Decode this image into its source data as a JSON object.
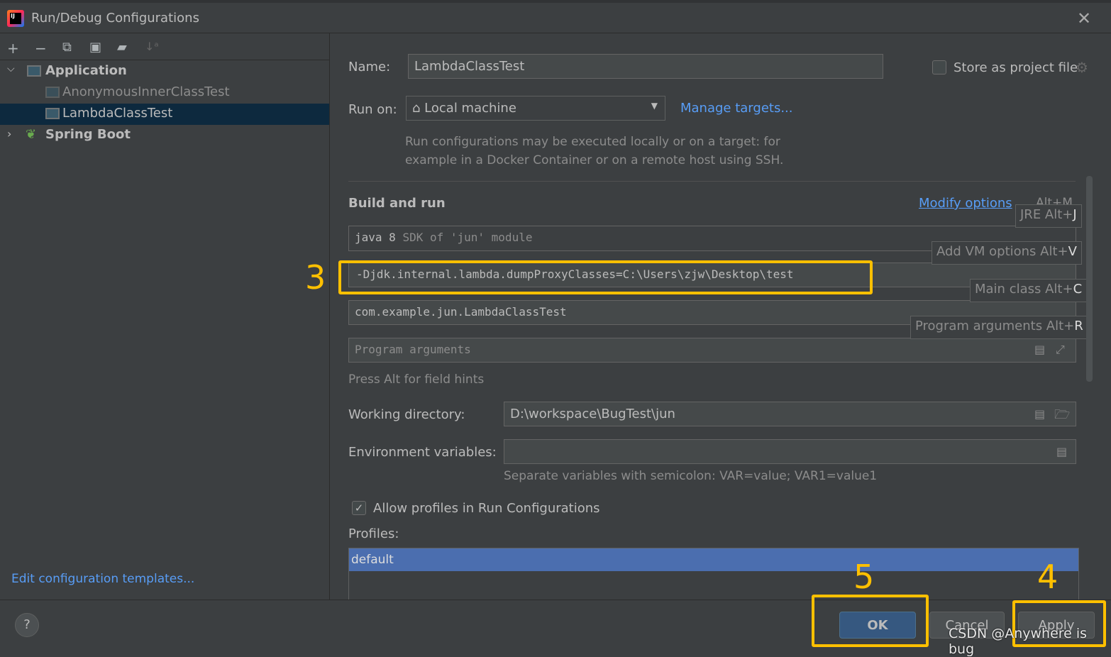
{
  "window": {
    "title": "Run/Debug Configurations"
  },
  "toolbar": {
    "icons": [
      "plus-icon",
      "minus-icon",
      "copy-icon",
      "save-icon",
      "new-folder-icon",
      "sort-icon"
    ]
  },
  "tree": {
    "groups": [
      {
        "label": "Application",
        "expanded": true,
        "items": [
          "AnonymousInnerClassTest",
          "LambdaClassTest"
        ],
        "selected": "LambdaClassTest"
      },
      {
        "label": "Spring Boot",
        "expanded": false
      }
    ]
  },
  "edit_templates": "Edit configuration templates...",
  "form": {
    "name_label": "Name:",
    "name_value": "LambdaClassTest",
    "store_label": "Store as project file",
    "store_checked": false,
    "run_on_label": "Run on:",
    "run_on_value": "Local machine",
    "manage_targets": "Manage targets...",
    "run_on_desc1": "Run configurations may be executed locally or on a target: for",
    "run_on_desc2": "example in a Docker Container or on a remote host using SSH.",
    "build_run": "Build and run",
    "modify_options": "Modify options",
    "modify_shortcut": "Alt+M",
    "jre_value": "java 8",
    "jre_hint": "SDK of 'jun' module",
    "vm_options": "-Djdk.internal.lambda.dumpProxyClasses=C:\\Users\\zjw\\Desktop\\test",
    "main_class": "com.example.jun.LambdaClassTest",
    "program_args_placeholder": "Program arguments",
    "field_hint": "Press Alt for field hints",
    "workdir_label": "Working directory:",
    "workdir_value": "D:\\workspace\\BugTest\\jun",
    "env_label": "Environment variables:",
    "env_value": "",
    "env_hint": "Separate variables with semicolon: VAR=value; VAR1=value1",
    "allow_profiles": "Allow profiles in Run Configurations",
    "allow_profiles_checked": true,
    "profiles_label": "Profiles:",
    "profiles": [
      "default"
    ]
  },
  "popups": {
    "jre": [
      "JRE Alt+",
      "J"
    ],
    "vm": [
      "Add VM options Alt+",
      "V"
    ],
    "main": [
      "Main class Alt+",
      "C"
    ],
    "args": [
      "Program arguments Alt+",
      "R"
    ]
  },
  "buttons": {
    "help": "?",
    "ok": "OK",
    "cancel": "Cancel",
    "apply": "Apply"
  },
  "annotations": {
    "a3": "3",
    "a4": "4",
    "a5": "5",
    "highlight_color": "#ffc000"
  },
  "watermark": "CSDN @Anywhere is bug"
}
